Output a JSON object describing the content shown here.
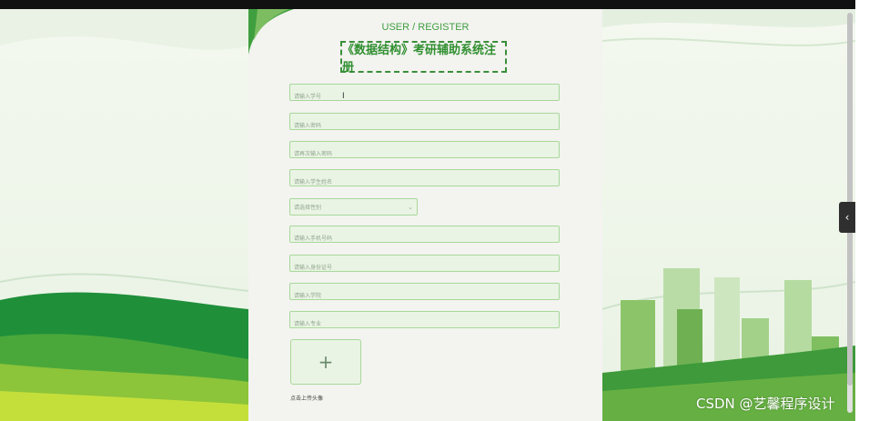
{
  "header": {
    "title_en": "USER / REGISTER",
    "title_cn": "《数据结构》考研辅助系统注册"
  },
  "form": {
    "fields": [
      {
        "placeholder": "请输入学号"
      },
      {
        "placeholder": "请输入密码"
      },
      {
        "placeholder": "请再次输入密码"
      },
      {
        "placeholder": "请输入学生姓名"
      }
    ],
    "gender_select": {
      "placeholder": "请选择性别"
    },
    "fields2": [
      {
        "placeholder": "请输入手机号码"
      },
      {
        "placeholder": "请输入身份证号"
      },
      {
        "placeholder": "请输入学院"
      },
      {
        "placeholder": "请输入专业"
      }
    ],
    "upload": {
      "icon_glyph": "+",
      "note": "点击上传头像"
    }
  },
  "watermark": "CSDN @艺馨程序设计",
  "side_tab_glyph": "‹",
  "colors": {
    "accent": "#3f9f3f",
    "field_bg": "#eaf4e4",
    "field_border": "#a8d89a"
  }
}
